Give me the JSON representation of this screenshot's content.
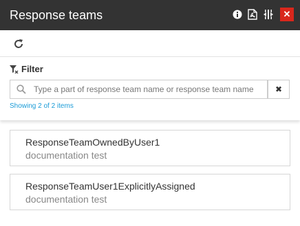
{
  "header": {
    "title": "Response teams",
    "icons": [
      "info-icon",
      "pdf-export-icon",
      "resize-icon",
      "close-icon"
    ],
    "close_symbol": "✕",
    "close_color": "#d9271c",
    "bg_color": "#333333"
  },
  "toolbar": {
    "refresh_icon": "refresh-icon"
  },
  "filter": {
    "label": "Filter",
    "placeholder": "Type a part of response team name or response team name",
    "value": "",
    "clear_symbol": "✖",
    "count_text": "Showing 2 of 2 items",
    "count_color": "#1a9bd7"
  },
  "teams": [
    {
      "name": "ResponseTeamOwnedByUser1",
      "description": "documentation test"
    },
    {
      "name": "ResponseTeamUser1ExplicitlyAssigned",
      "description": "documentation test"
    }
  ]
}
